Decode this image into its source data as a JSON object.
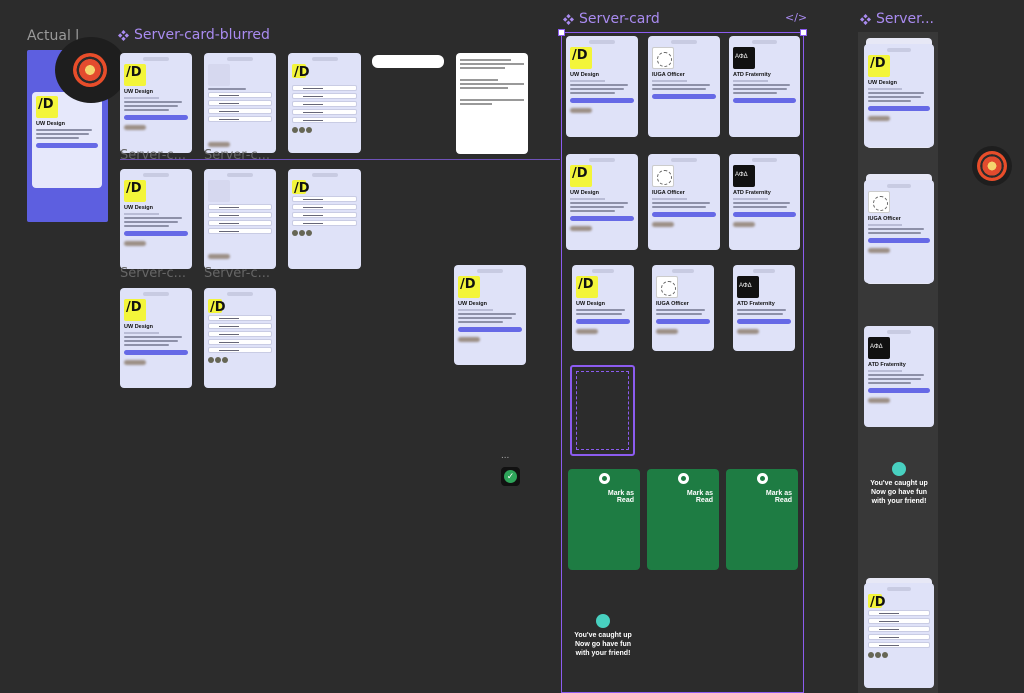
{
  "frames": {
    "actual_label": "Actual l",
    "blurred_label": "Server-card-blurred",
    "server_card_label": "Server-card",
    "server_right_label": "Server...",
    "code_icon": "</>",
    "repeat_label": "Server-c..."
  },
  "cards": {
    "uw": {
      "title": "UW Design"
    },
    "iuga": {
      "title": "IUGA Officer"
    },
    "atd": {
      "title": "ATD Fraternity"
    }
  },
  "mark_read": "Mark as\nRead",
  "caught_up": {
    "line1": "You've caught up",
    "line2": "Now go have fun",
    "line3": "with your friend!"
  },
  "menu_dots": "...",
  "colors": {
    "accent": "#8c5cf0",
    "green": "#1e7c43",
    "card": "#dfe2f8",
    "button": "#6669e6"
  }
}
